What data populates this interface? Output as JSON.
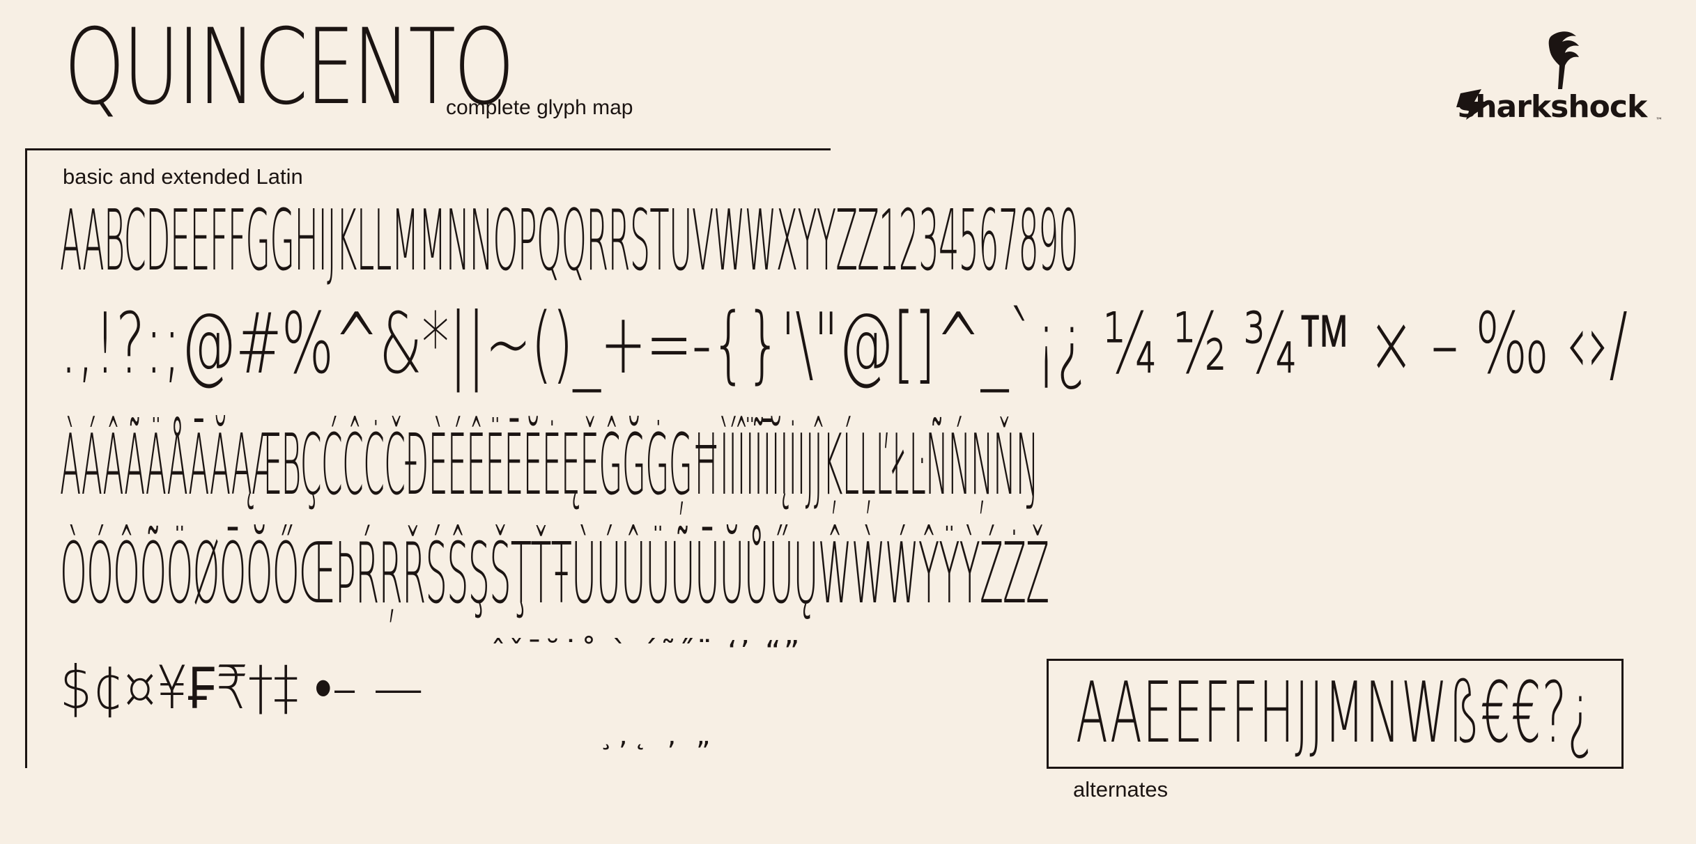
{
  "header": {
    "title": "QUINCENTO",
    "subtitle": "complete glyph map"
  },
  "brand": {
    "name": "sharkshock",
    "trademark": "™"
  },
  "section": {
    "label": "basic and extended Latin"
  },
  "glyph_rows": [
    "AABCDEEFFGGHIJKLLMMNNOPQQRRSTUVWWXYYZZ1234567890",
    ".,!?:;@#%^&*||~()_+=-{}'\\\"@[]^_`¡¿ ¼ ½ ¾™ × – ‰ ‹›/",
    "ÀÁÂÃÄÅĀĂĄÆBÇĆĈĊČĐÈÉÊËĒĔĖĘĚĜĞĠĢĦÌÍÎÏĨĪĬĮİIJĴĶĹĻĽŁĿÑŃŅŇŊ",
    "ÒÓÔÕÖØŌŎŐŒÞŔŖŘŚŜŞŠŢŤŦÙÚÛÜŨŪŬŮŰŲŴẀẂŶŸỲŹŻŽ",
    "$¢¤¥₣₹†‡ •– —"
  ],
  "marks": {
    "top": "ˆˇ¯˘˙˚  ` ´˜˝¨ ‘’ “”",
    "bottom": "¸,˛          ‚     „"
  },
  "alternates": {
    "glyphs": "AAEEFFHJJMNWß€€?¿",
    "label": "alternates"
  },
  "colors": {
    "background": "#f7efe4",
    "ink": "#1b1412"
  }
}
